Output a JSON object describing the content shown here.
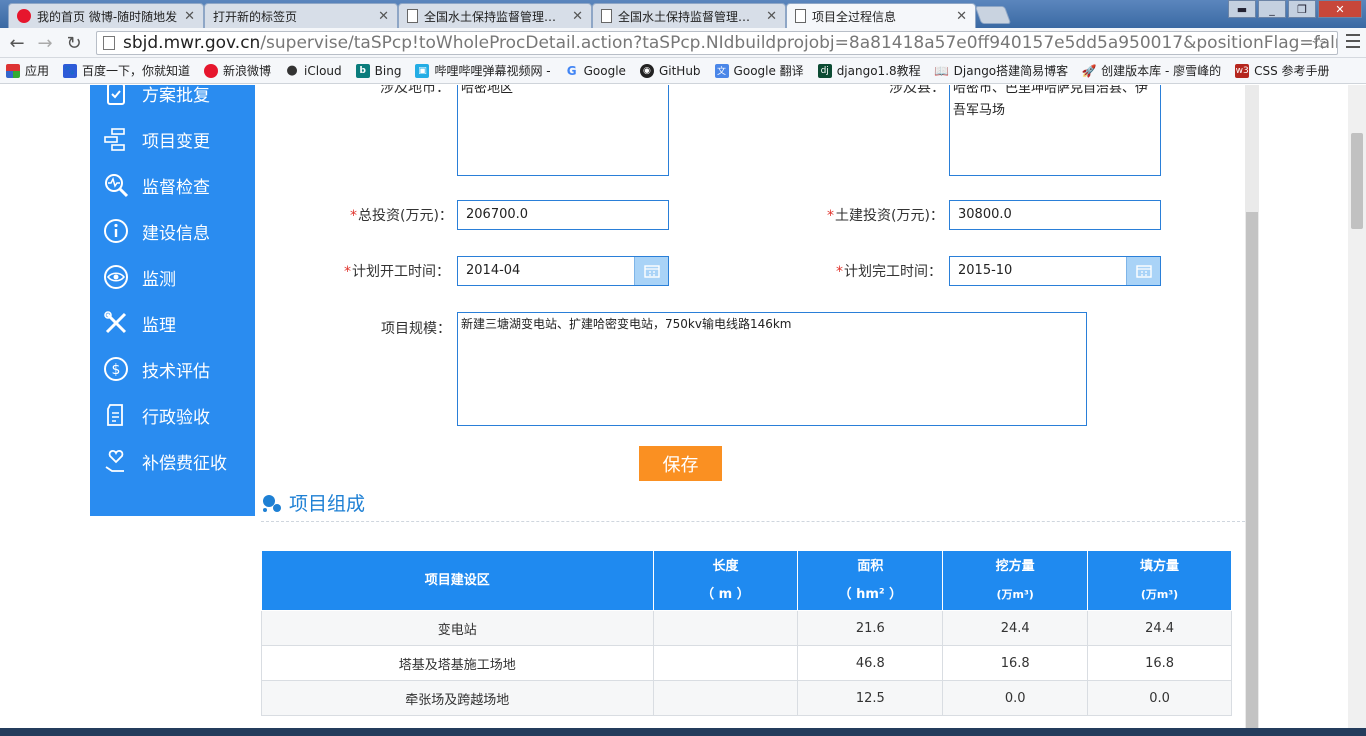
{
  "browser": {
    "tabs": [
      {
        "title": "我的首页 微博-随时随地发",
        "active": false
      },
      {
        "title": "打开新的标签页",
        "active": false
      },
      {
        "title": "全国水土保持监督管理系统",
        "active": false
      },
      {
        "title": "全国水土保持监督管理系统",
        "active": false
      },
      {
        "title": "项目全过程信息",
        "active": true
      }
    ],
    "url_host": "sbjd.mwr.gov.cn",
    "url_path": "/supervise/taSPcp!toWholeProcDetail.action?taSPcp.NIdbuildprojobj=8a81418a57e0ff940157e5dd5a950017&positionFlag=falr",
    "bookmarks": [
      "应用",
      "百度一下，你就知道",
      "新浪微博",
      "iCloud",
      "Bing",
      "哔哩哔哩弹幕视频网 -",
      "Google",
      "GitHub",
      "Google 翻译",
      "django1.8教程",
      "Django搭建简易博客",
      "创建版本库 - 廖雪峰的",
      "CSS 参考手册"
    ]
  },
  "sidebar": {
    "items": [
      "方案批复",
      "项目变更",
      "监督检查",
      "建设信息",
      "监测",
      "监理",
      "技术评估",
      "行政验收",
      "补偿费征收"
    ]
  },
  "form": {
    "region_label": "涉及地市：",
    "region_value": "哈密地区",
    "county_label": "涉及县：",
    "county_value": "哈密市、巴里坤哈萨克自治县、伊吾军马场",
    "total_invest_label": "总投资(万元)：",
    "total_invest_value": "206700.0",
    "civil_invest_label": "土建投资(万元)：",
    "civil_invest_value": "30800.0",
    "plan_start_label": "计划开工时间：",
    "plan_start_value": "2014-04",
    "plan_end_label": "计划完工时间：",
    "plan_end_value": "2015-10",
    "scale_label": "项目规模：",
    "scale_value": "新建三塘湖变电站、扩建哈密变电站，750kv输电线路146km",
    "required_mark": "*",
    "save_label": "保存"
  },
  "composition": {
    "title": "项目组成",
    "headers": [
      {
        "line1": "项目建设区",
        "line2": ""
      },
      {
        "line1": "长度",
        "line2": "（ m ）"
      },
      {
        "line1": "面积",
        "line2": "（ hm² ）"
      },
      {
        "line1": "挖方量",
        "line2": "(万m³)"
      },
      {
        "line1": "填方量",
        "line2": "(万m³)"
      }
    ],
    "rows": [
      [
        "变电站",
        "",
        "21.6",
        "24.4",
        "24.4"
      ],
      [
        "塔基及塔基施工场地",
        "",
        "46.8",
        "16.8",
        "16.8"
      ],
      [
        "牵张场及跨越场地",
        "",
        "12.5",
        "0.0",
        "0.0"
      ]
    ]
  },
  "colors": {
    "sidebar": "#2a8cf0",
    "table_header": "#1f8af0",
    "save_button": "#fa9022",
    "section_title": "#1e80d4",
    "required": "#e0322b"
  }
}
